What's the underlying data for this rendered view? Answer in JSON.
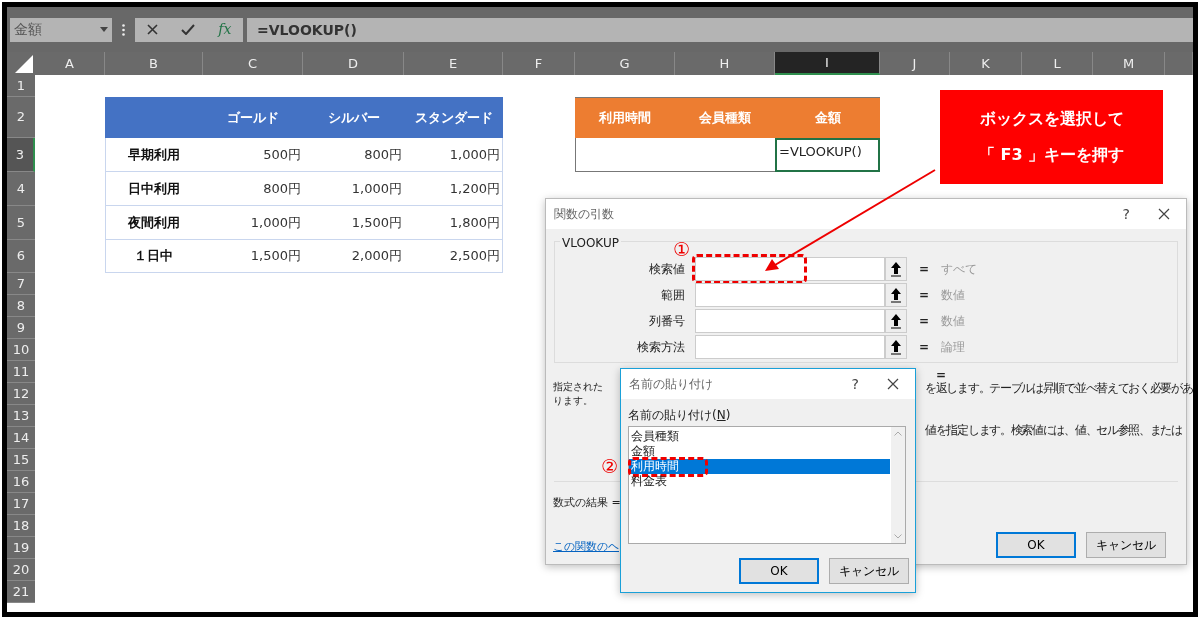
{
  "formula_bar": {
    "name_box": "金額",
    "insert_function": "fx",
    "formula": "=VLOOKUP()"
  },
  "columns": [
    {
      "label": "A",
      "selected": false
    },
    {
      "label": "B",
      "selected": false
    },
    {
      "label": "C",
      "selected": false
    },
    {
      "label": "D",
      "selected": false
    },
    {
      "label": "E",
      "selected": false
    },
    {
      "label": "F",
      "selected": false
    },
    {
      "label": "G",
      "selected": false
    },
    {
      "label": "H",
      "selected": false
    },
    {
      "label": "I",
      "selected": true
    },
    {
      "label": "J",
      "selected": false
    },
    {
      "label": "K",
      "selected": false
    },
    {
      "label": "L",
      "selected": false
    },
    {
      "label": "M",
      "selected": false
    }
  ],
  "rows": [
    {
      "label": "1",
      "selected": false
    },
    {
      "label": "2",
      "selected": false
    },
    {
      "label": "3",
      "selected": true
    },
    {
      "label": "4",
      "selected": false
    },
    {
      "label": "5",
      "selected": false
    },
    {
      "label": "6",
      "selected": false
    },
    {
      "label": "7",
      "selected": false
    },
    {
      "label": "8",
      "selected": false
    },
    {
      "label": "9",
      "selected": false
    },
    {
      "label": "10",
      "selected": false
    },
    {
      "label": "11",
      "selected": false
    },
    {
      "label": "12",
      "selected": false
    },
    {
      "label": "13",
      "selected": false
    },
    {
      "label": "14",
      "selected": false
    },
    {
      "label": "15",
      "selected": false
    },
    {
      "label": "16",
      "selected": false
    },
    {
      "label": "17",
      "selected": false
    },
    {
      "label": "18",
      "selected": false
    },
    {
      "label": "19",
      "selected": false
    },
    {
      "label": "20",
      "selected": false
    },
    {
      "label": "21",
      "selected": false
    }
  ],
  "price_table": {
    "columns": [
      "ゴールド",
      "シルバー",
      "スタンダード"
    ],
    "rows": [
      {
        "label": "早期利用",
        "values": [
          "500円",
          "800円",
          "1,000円"
        ]
      },
      {
        "label": "日中利用",
        "values": [
          "800円",
          "1,000円",
          "1,200円"
        ]
      },
      {
        "label": "夜間利用",
        "values": [
          "1,000円",
          "1,500円",
          "1,800円"
        ]
      },
      {
        "label": "１日中",
        "values": [
          "1,500円",
          "2,000円",
          "2,500円"
        ]
      }
    ]
  },
  "lookup_table": {
    "columns": [
      "利用時間",
      "会員種類",
      "金額"
    ],
    "cells": [
      {
        "active": false
      },
      {
        "active": false
      },
      {
        "value": "=VLOOKUP()",
        "active": true
      }
    ]
  },
  "callout": {
    "lines": [
      "ボックスを選択して",
      "「 F3 」キーを押す"
    ]
  },
  "function_dialog": {
    "title": "関数の引数",
    "help": "?",
    "function": "VLOOKUP",
    "arguments": [
      {
        "label": "検索値",
        "equals": "=",
        "type": "すべて",
        "highlighted": true,
        "marker": "①"
      },
      {
        "label": "範囲",
        "equals": "=",
        "type": "数値",
        "highlighted": false
      },
      {
        "label": "列番号",
        "equals": "=",
        "type": "数値",
        "highlighted": false
      },
      {
        "label": "検索方法",
        "equals": "=",
        "type": "論理",
        "highlighted": false
      }
    ],
    "result_equals": "=",
    "description": [
      {
        "left": "指定された",
        "right": "を返します。テーブルは昇順で並べ替えておく必要があ"
      },
      {
        "left": "ります。"
      },
      {
        "right": "値を指定します。検索値には、値、セル参照、または"
      }
    ],
    "formula_result": "数式の結果 =",
    "help_link": "この関数のヘ",
    "buttons": [
      {
        "label": "OK",
        "default": true
      },
      {
        "label": "キャンセル",
        "default": false
      }
    ]
  },
  "paste_names_dialog": {
    "title": "名前の貼り付け",
    "help": "?",
    "label": "名前の貼り付け(N)",
    "names": [
      {
        "label": "会員種類",
        "selected": false,
        "highlighted": false
      },
      {
        "label": "金額",
        "selected": false,
        "highlighted": false
      },
      {
        "label": "利用時間",
        "selected": true,
        "highlighted": true,
        "marker": "②"
      },
      {
        "label": "料金表",
        "selected": false,
        "highlighted": false
      }
    ],
    "buttons": [
      {
        "label": "OK",
        "default": true
      },
      {
        "label": "キャンセル",
        "default": false
      }
    ]
  }
}
